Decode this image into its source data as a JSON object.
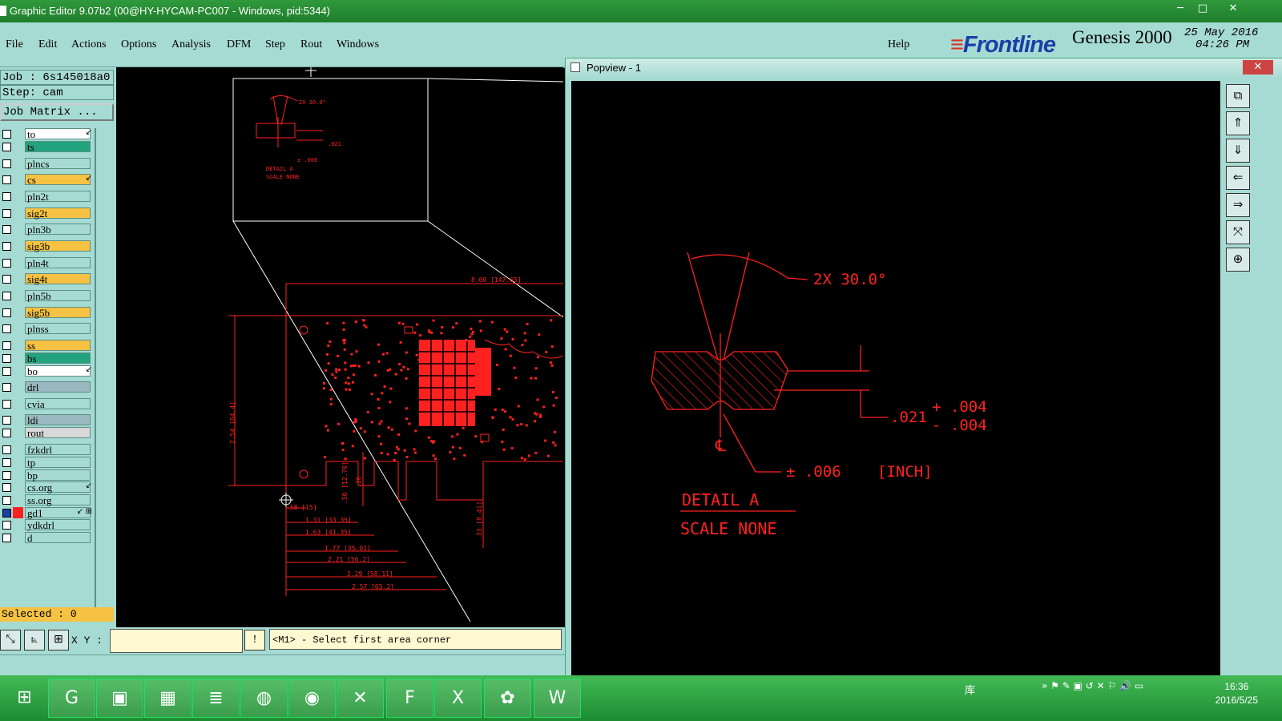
{
  "window": {
    "title": "Graphic Editor 9.07b2 (00@HY-HYCAM-PC007 - Windows, pid:5344)"
  },
  "menu": {
    "items": [
      "File",
      "Edit",
      "Actions",
      "Options",
      "Analysis",
      "DFM",
      "Step",
      "Rout",
      "Windows"
    ],
    "help": "Help"
  },
  "brand": {
    "logo": "Frontline",
    "product": "Genesis 2000",
    "date": "25 May 2016",
    "time": "04:26 PM"
  },
  "job": {
    "job_label": "Job : 6s145018a0",
    "step_label": "Step: cam",
    "matrix_button": "Job Matrix ..."
  },
  "layers": [
    {
      "name": "to",
      "color": "#ffffff",
      "mark": "↙"
    },
    {
      "name": "ts",
      "color": "#22a37d",
      "mark": ""
    },
    {
      "name": "plncs",
      "color": "#a6dbd3",
      "mark": ""
    },
    {
      "name": "cs",
      "color": "#f5c244",
      "mark": "↙"
    },
    {
      "name": "pln2t",
      "color": "#a6dbd3",
      "mark": ""
    },
    {
      "name": "sig2t",
      "color": "#f5c244",
      "mark": ""
    },
    {
      "name": "pln3b",
      "color": "#a6dbd3",
      "mark": ""
    },
    {
      "name": "sig3b",
      "color": "#f5c244",
      "mark": ""
    },
    {
      "name": "pln4t",
      "color": "#a6dbd3",
      "mark": ""
    },
    {
      "name": "sig4t",
      "color": "#f5c244",
      "mark": ""
    },
    {
      "name": "pln5b",
      "color": "#a6dbd3",
      "mark": ""
    },
    {
      "name": "sig5b",
      "color": "#f5c244",
      "mark": ""
    },
    {
      "name": "plnss",
      "color": "#a6dbd3",
      "mark": ""
    },
    {
      "name": "ss",
      "color": "#f5c244",
      "mark": ""
    },
    {
      "name": "bs",
      "color": "#22a37d",
      "mark": ""
    },
    {
      "name": "bo",
      "color": "#ffffff",
      "mark": "↙"
    },
    {
      "name": "drl",
      "color": "#9ab8c0",
      "mark": ""
    },
    {
      "name": "cvia",
      "color": "#a6dbd3",
      "mark": ""
    },
    {
      "name": "ldi",
      "color": "#9ab8c0",
      "mark": ""
    },
    {
      "name": "rout",
      "color": "#d8d8d8",
      "mark": ""
    },
    {
      "name": "fzkdrl",
      "color": "#a6dbd3",
      "mark": ""
    },
    {
      "name": "tp",
      "color": "#a6dbd3",
      "mark": ""
    },
    {
      "name": "bp",
      "color": "#a6dbd3",
      "mark": ""
    },
    {
      "name": "cs.org",
      "color": "#a6dbd3",
      "mark": "↙"
    },
    {
      "name": "ss.org",
      "color": "#a6dbd3",
      "mark": ""
    },
    {
      "name": "gd1",
      "color": "#a6dbd3",
      "mark": "↙ ⊞",
      "active": true
    },
    {
      "name": "ydkdrl",
      "color": "#a6dbd3",
      "mark": ""
    },
    {
      "name": "d",
      "color": "#a6dbd3",
      "mark": ""
    }
  ],
  "selected_label": "Selected : 0",
  "coords": {
    "label": "X Y :",
    "value": ""
  },
  "status_message": "<M1> - Select first area corner",
  "popview": {
    "title": "Popview - 1"
  },
  "drawing": {
    "angle_label": "2X 30.0°",
    "thickness_value": ".021",
    "tol_plus": "+ .004",
    "tol_minus": "- .004",
    "tol_general": "± .006",
    "units": "[INCH]",
    "centerline": "℄",
    "detail_title": "DETAIL A",
    "detail_scale": "SCALE NONE",
    "dims": [
      "8.60 [147.65]",
      "2.54 [64.4]",
      ".58 [15]",
      "1.31 [33.35]",
      "1.63 [41.35]",
      "1.77 [45.01]",
      "2.21 [56.2]",
      "2.29 [58.11]",
      "2.57 [65.2]",
      ".33 [8.41]",
      ".50 [12.70]",
      ".26"
    ]
  },
  "taskbar": {
    "clock_time": "16:36",
    "clock_date": "2016/5/25",
    "tray_label": "库"
  },
  "colors": {
    "drawing": "#ff2020",
    "panel": "#a6dbd3",
    "taskbar": "#2a9d3b"
  }
}
